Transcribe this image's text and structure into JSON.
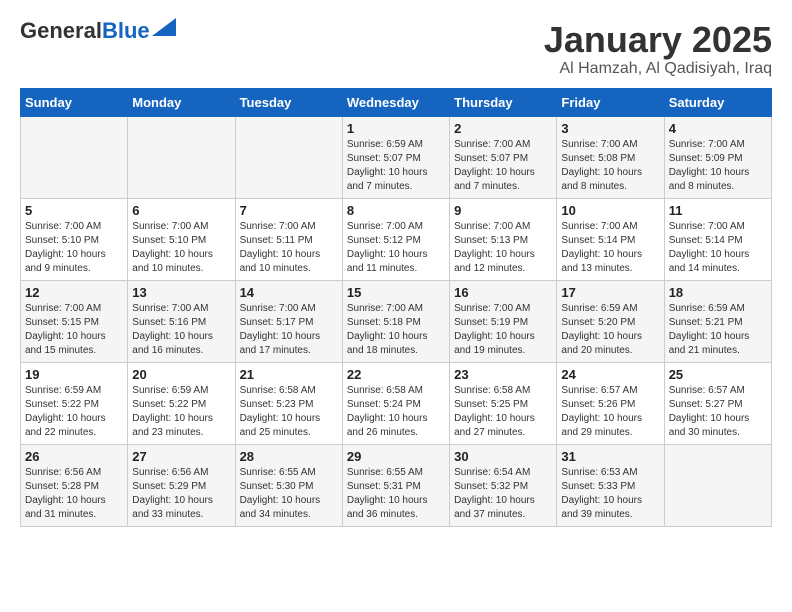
{
  "header": {
    "logo_general": "General",
    "logo_blue": "Blue",
    "title": "January 2025",
    "subtitle": "Al Hamzah, Al Qadisiyah, Iraq"
  },
  "weekdays": [
    "Sunday",
    "Monday",
    "Tuesday",
    "Wednesday",
    "Thursday",
    "Friday",
    "Saturday"
  ],
  "weeks": [
    [
      {
        "day": "",
        "sunrise": "",
        "sunset": "",
        "daylight": ""
      },
      {
        "day": "",
        "sunrise": "",
        "sunset": "",
        "daylight": ""
      },
      {
        "day": "",
        "sunrise": "",
        "sunset": "",
        "daylight": ""
      },
      {
        "day": "1",
        "sunrise": "Sunrise: 6:59 AM",
        "sunset": "Sunset: 5:07 PM",
        "daylight": "Daylight: 10 hours and 7 minutes."
      },
      {
        "day": "2",
        "sunrise": "Sunrise: 7:00 AM",
        "sunset": "Sunset: 5:07 PM",
        "daylight": "Daylight: 10 hours and 7 minutes."
      },
      {
        "day": "3",
        "sunrise": "Sunrise: 7:00 AM",
        "sunset": "Sunset: 5:08 PM",
        "daylight": "Daylight: 10 hours and 8 minutes."
      },
      {
        "day": "4",
        "sunrise": "Sunrise: 7:00 AM",
        "sunset": "Sunset: 5:09 PM",
        "daylight": "Daylight: 10 hours and 8 minutes."
      }
    ],
    [
      {
        "day": "5",
        "sunrise": "Sunrise: 7:00 AM",
        "sunset": "Sunset: 5:10 PM",
        "daylight": "Daylight: 10 hours and 9 minutes."
      },
      {
        "day": "6",
        "sunrise": "Sunrise: 7:00 AM",
        "sunset": "Sunset: 5:10 PM",
        "daylight": "Daylight: 10 hours and 10 minutes."
      },
      {
        "day": "7",
        "sunrise": "Sunrise: 7:00 AM",
        "sunset": "Sunset: 5:11 PM",
        "daylight": "Daylight: 10 hours and 10 minutes."
      },
      {
        "day": "8",
        "sunrise": "Sunrise: 7:00 AM",
        "sunset": "Sunset: 5:12 PM",
        "daylight": "Daylight: 10 hours and 11 minutes."
      },
      {
        "day": "9",
        "sunrise": "Sunrise: 7:00 AM",
        "sunset": "Sunset: 5:13 PM",
        "daylight": "Daylight: 10 hours and 12 minutes."
      },
      {
        "day": "10",
        "sunrise": "Sunrise: 7:00 AM",
        "sunset": "Sunset: 5:14 PM",
        "daylight": "Daylight: 10 hours and 13 minutes."
      },
      {
        "day": "11",
        "sunrise": "Sunrise: 7:00 AM",
        "sunset": "Sunset: 5:14 PM",
        "daylight": "Daylight: 10 hours and 14 minutes."
      }
    ],
    [
      {
        "day": "12",
        "sunrise": "Sunrise: 7:00 AM",
        "sunset": "Sunset: 5:15 PM",
        "daylight": "Daylight: 10 hours and 15 minutes."
      },
      {
        "day": "13",
        "sunrise": "Sunrise: 7:00 AM",
        "sunset": "Sunset: 5:16 PM",
        "daylight": "Daylight: 10 hours and 16 minutes."
      },
      {
        "day": "14",
        "sunrise": "Sunrise: 7:00 AM",
        "sunset": "Sunset: 5:17 PM",
        "daylight": "Daylight: 10 hours and 17 minutes."
      },
      {
        "day": "15",
        "sunrise": "Sunrise: 7:00 AM",
        "sunset": "Sunset: 5:18 PM",
        "daylight": "Daylight: 10 hours and 18 minutes."
      },
      {
        "day": "16",
        "sunrise": "Sunrise: 7:00 AM",
        "sunset": "Sunset: 5:19 PM",
        "daylight": "Daylight: 10 hours and 19 minutes."
      },
      {
        "day": "17",
        "sunrise": "Sunrise: 6:59 AM",
        "sunset": "Sunset: 5:20 PM",
        "daylight": "Daylight: 10 hours and 20 minutes."
      },
      {
        "day": "18",
        "sunrise": "Sunrise: 6:59 AM",
        "sunset": "Sunset: 5:21 PM",
        "daylight": "Daylight: 10 hours and 21 minutes."
      }
    ],
    [
      {
        "day": "19",
        "sunrise": "Sunrise: 6:59 AM",
        "sunset": "Sunset: 5:22 PM",
        "daylight": "Daylight: 10 hours and 22 minutes."
      },
      {
        "day": "20",
        "sunrise": "Sunrise: 6:59 AM",
        "sunset": "Sunset: 5:22 PM",
        "daylight": "Daylight: 10 hours and 23 minutes."
      },
      {
        "day": "21",
        "sunrise": "Sunrise: 6:58 AM",
        "sunset": "Sunset: 5:23 PM",
        "daylight": "Daylight: 10 hours and 25 minutes."
      },
      {
        "day": "22",
        "sunrise": "Sunrise: 6:58 AM",
        "sunset": "Sunset: 5:24 PM",
        "daylight": "Daylight: 10 hours and 26 minutes."
      },
      {
        "day": "23",
        "sunrise": "Sunrise: 6:58 AM",
        "sunset": "Sunset: 5:25 PM",
        "daylight": "Daylight: 10 hours and 27 minutes."
      },
      {
        "day": "24",
        "sunrise": "Sunrise: 6:57 AM",
        "sunset": "Sunset: 5:26 PM",
        "daylight": "Daylight: 10 hours and 29 minutes."
      },
      {
        "day": "25",
        "sunrise": "Sunrise: 6:57 AM",
        "sunset": "Sunset: 5:27 PM",
        "daylight": "Daylight: 10 hours and 30 minutes."
      }
    ],
    [
      {
        "day": "26",
        "sunrise": "Sunrise: 6:56 AM",
        "sunset": "Sunset: 5:28 PM",
        "daylight": "Daylight: 10 hours and 31 minutes."
      },
      {
        "day": "27",
        "sunrise": "Sunrise: 6:56 AM",
        "sunset": "Sunset: 5:29 PM",
        "daylight": "Daylight: 10 hours and 33 minutes."
      },
      {
        "day": "28",
        "sunrise": "Sunrise: 6:55 AM",
        "sunset": "Sunset: 5:30 PM",
        "daylight": "Daylight: 10 hours and 34 minutes."
      },
      {
        "day": "29",
        "sunrise": "Sunrise: 6:55 AM",
        "sunset": "Sunset: 5:31 PM",
        "daylight": "Daylight: 10 hours and 36 minutes."
      },
      {
        "day": "30",
        "sunrise": "Sunrise: 6:54 AM",
        "sunset": "Sunset: 5:32 PM",
        "daylight": "Daylight: 10 hours and 37 minutes."
      },
      {
        "day": "31",
        "sunrise": "Sunrise: 6:53 AM",
        "sunset": "Sunset: 5:33 PM",
        "daylight": "Daylight: 10 hours and 39 minutes."
      },
      {
        "day": "",
        "sunrise": "",
        "sunset": "",
        "daylight": ""
      }
    ]
  ]
}
